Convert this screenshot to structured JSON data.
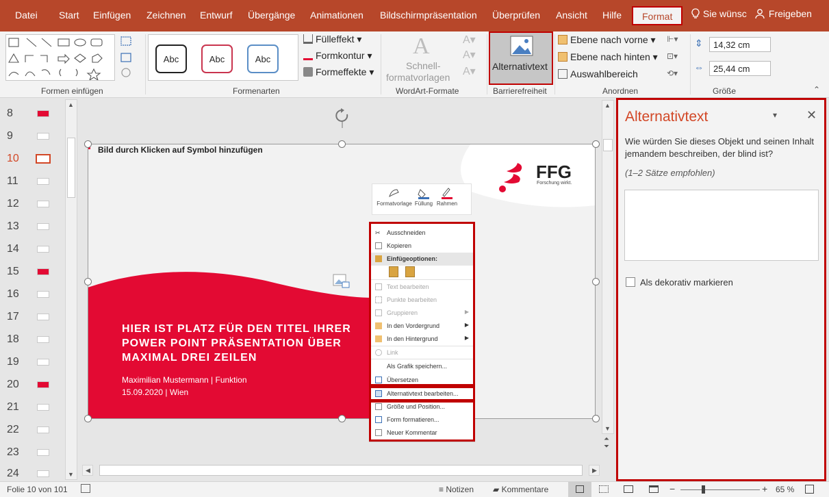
{
  "menu": {
    "tabs": [
      "Datei",
      "Start",
      "Einfügen",
      "Zeichnen",
      "Entwurf",
      "Übergänge",
      "Animationen",
      "Bildschirmpräsentation",
      "Überprüfen",
      "Ansicht",
      "Hilfe",
      "Format"
    ],
    "active_tab": "Format",
    "tell_me": "Sie wünsc",
    "share": "Freigeben"
  },
  "ribbon": {
    "groups": {
      "shapes": "Formen einfügen",
      "styles": "Formenarten",
      "wordart": "WordArt-Formate",
      "accessibility": "Barrierefreiheit",
      "arrange": "Anordnen",
      "size": "Größe"
    },
    "style_samples": [
      "Abc",
      "Abc",
      "Abc"
    ],
    "fill": "Fülleffekt",
    "outline": "Formkontur",
    "effects": "Formeffekte",
    "quick_styles_1": "Schnell-",
    "quick_styles_2": "formatvorlagen",
    "alt_text": "Alternativtext",
    "bring_forward": "Ebene nach vorne",
    "send_backward": "Ebene nach hinten",
    "selection_pane": "Auswahlbereich",
    "height": "14,32 cm",
    "width": "25,44 cm"
  },
  "thumbnails": [
    "8",
    "9",
    "10",
    "11",
    "12",
    "13",
    "14",
    "15",
    "16",
    "17",
    "18",
    "19",
    "20",
    "21",
    "22",
    "23",
    "24"
  ],
  "current_slide": "10",
  "slide": {
    "placeholder": "Bild durch Klicken auf Symbol hinzufügen",
    "logo_text": "FFG",
    "logo_sub": "Forschung wirkt.",
    "title": "HIER IST PLATZ FÜR DEN TITEL IHRER POWER POINT PRÄSENTATION ÜBER MAXIMAL DREI ZEILEN",
    "author": "Maximilian Mustermann | Funktion",
    "date": "15.09.2020 | Wien"
  },
  "mini_toolbar": [
    "Formatvorlage",
    "Füllung",
    "Rahmen"
  ],
  "context_menu": [
    {
      "label": "Ausschneiden",
      "disabled": false
    },
    {
      "label": "Kopieren",
      "disabled": false
    },
    {
      "label": "Einfügeoptionen:",
      "disabled": false
    },
    {
      "label": "Text bearbeiten",
      "disabled": true
    },
    {
      "label": "Punkte bearbeiten",
      "disabled": true
    },
    {
      "label": "Gruppieren",
      "disabled": true
    },
    {
      "label": "In den Vordergrund",
      "disabled": false
    },
    {
      "label": "In den Hintergrund",
      "disabled": false
    },
    {
      "label": "Link",
      "disabled": true
    },
    {
      "label": "Als Grafik speichern...",
      "disabled": false
    },
    {
      "label": "Übersetzen",
      "disabled": false
    },
    {
      "label": "Alternativtext bearbeiten...",
      "disabled": false
    },
    {
      "label": "Größe und Position...",
      "disabled": false
    },
    {
      "label": "Form formatieren...",
      "disabled": false
    },
    {
      "label": "Neuer Kommentar",
      "disabled": false
    }
  ],
  "pane": {
    "title": "Alternativtext",
    "question": "Wie würden Sie dieses Objekt und seinen Inhalt jemandem beschreiben, der blind ist?",
    "hint": "(1–2 Sätze empfohlen)",
    "decorative": "Als dekorativ markieren"
  },
  "status": {
    "slide_info": "Folie 10 von 101",
    "notes": "Notizen",
    "comments": "Kommentare",
    "zoom": "65 %"
  },
  "colors": {
    "accent": "#b7472a",
    "highlight": "#c00000",
    "brand": "#e30a33"
  }
}
